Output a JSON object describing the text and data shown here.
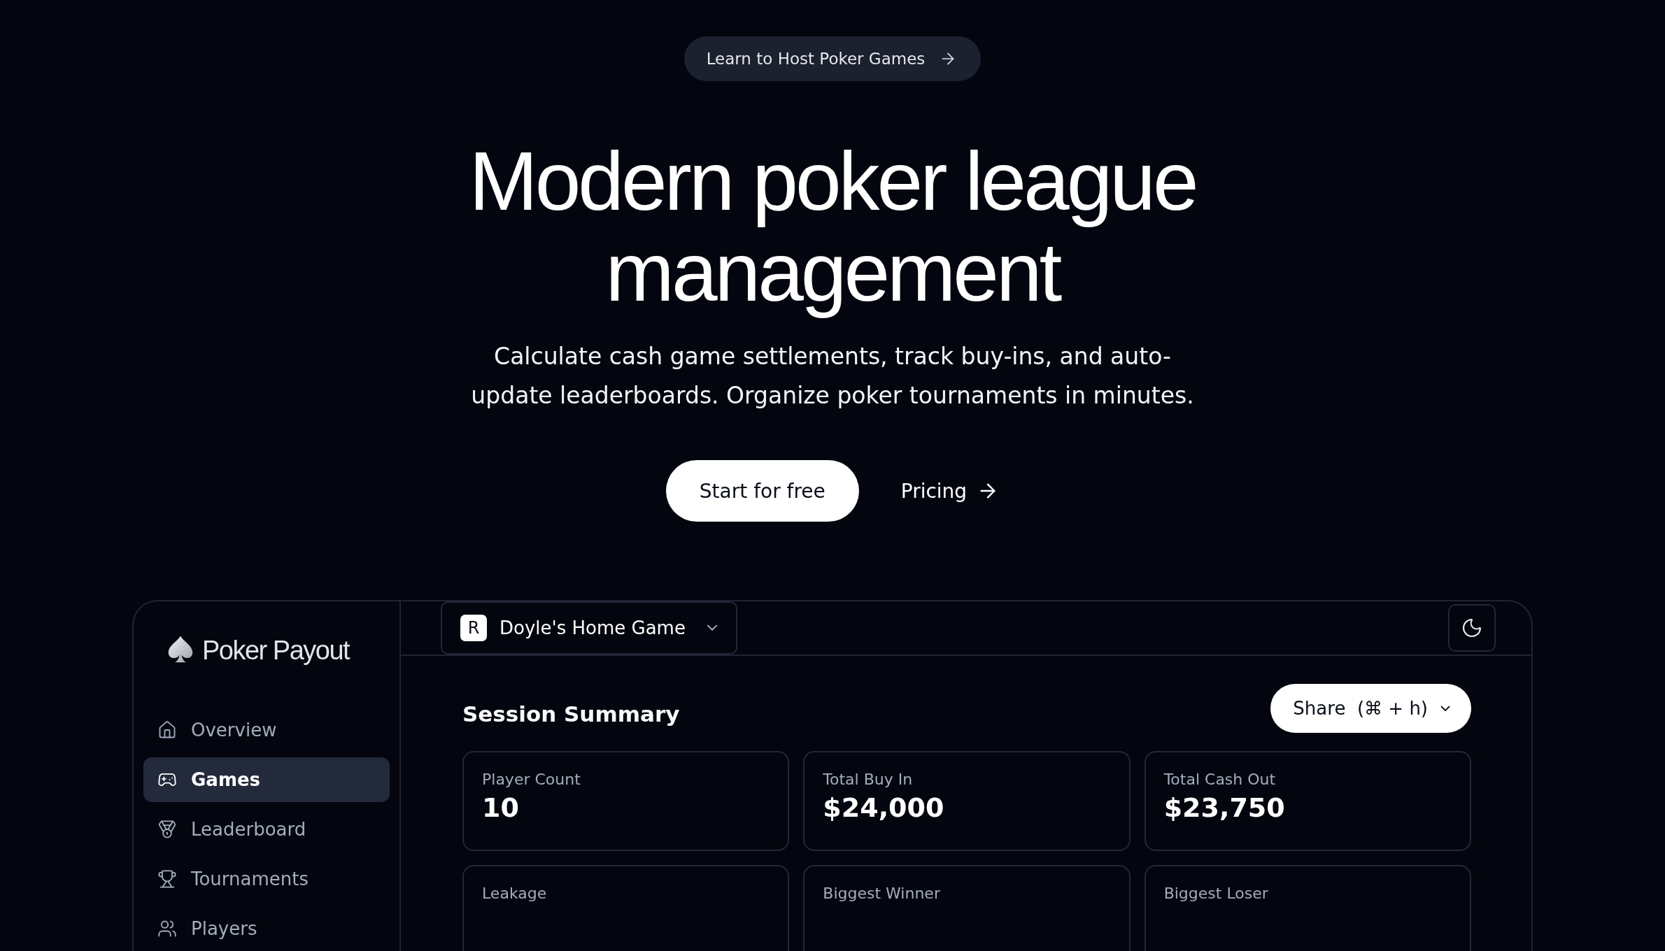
{
  "announcement": {
    "label": "Learn to Host Poker Games"
  },
  "hero": {
    "title_lines": [
      "Modern poker league",
      "management"
    ],
    "subtitle": "Calculate cash game settlements, track buy-ins, and auto-update leaderboards. Organize poker tournaments in minutes.",
    "primary_button": "Start for free",
    "secondary_link": "Pricing"
  },
  "app": {
    "brand": "Poker Payout",
    "sidebar": {
      "items": [
        {
          "label": "Overview",
          "selected": false
        },
        {
          "label": "Games",
          "selected": true
        },
        {
          "label": "Leaderboard",
          "selected": false
        },
        {
          "label": "Tournaments",
          "selected": false
        },
        {
          "label": "Players",
          "selected": false
        }
      ]
    },
    "workspace": {
      "initial": "R",
      "name": "Doyle's Home Game"
    },
    "section_title": "Session Summary",
    "share_button": "Share  (⌘ + h)",
    "stats": [
      {
        "label": "Player Count",
        "value": "10"
      },
      {
        "label": "Total Buy In",
        "value": "$24,000"
      },
      {
        "label": "Total Cash Out",
        "value": "$23,750"
      },
      {
        "label": "Leakage"
      },
      {
        "label": "Biggest Winner"
      },
      {
        "label": "Biggest Loser"
      }
    ]
  }
}
